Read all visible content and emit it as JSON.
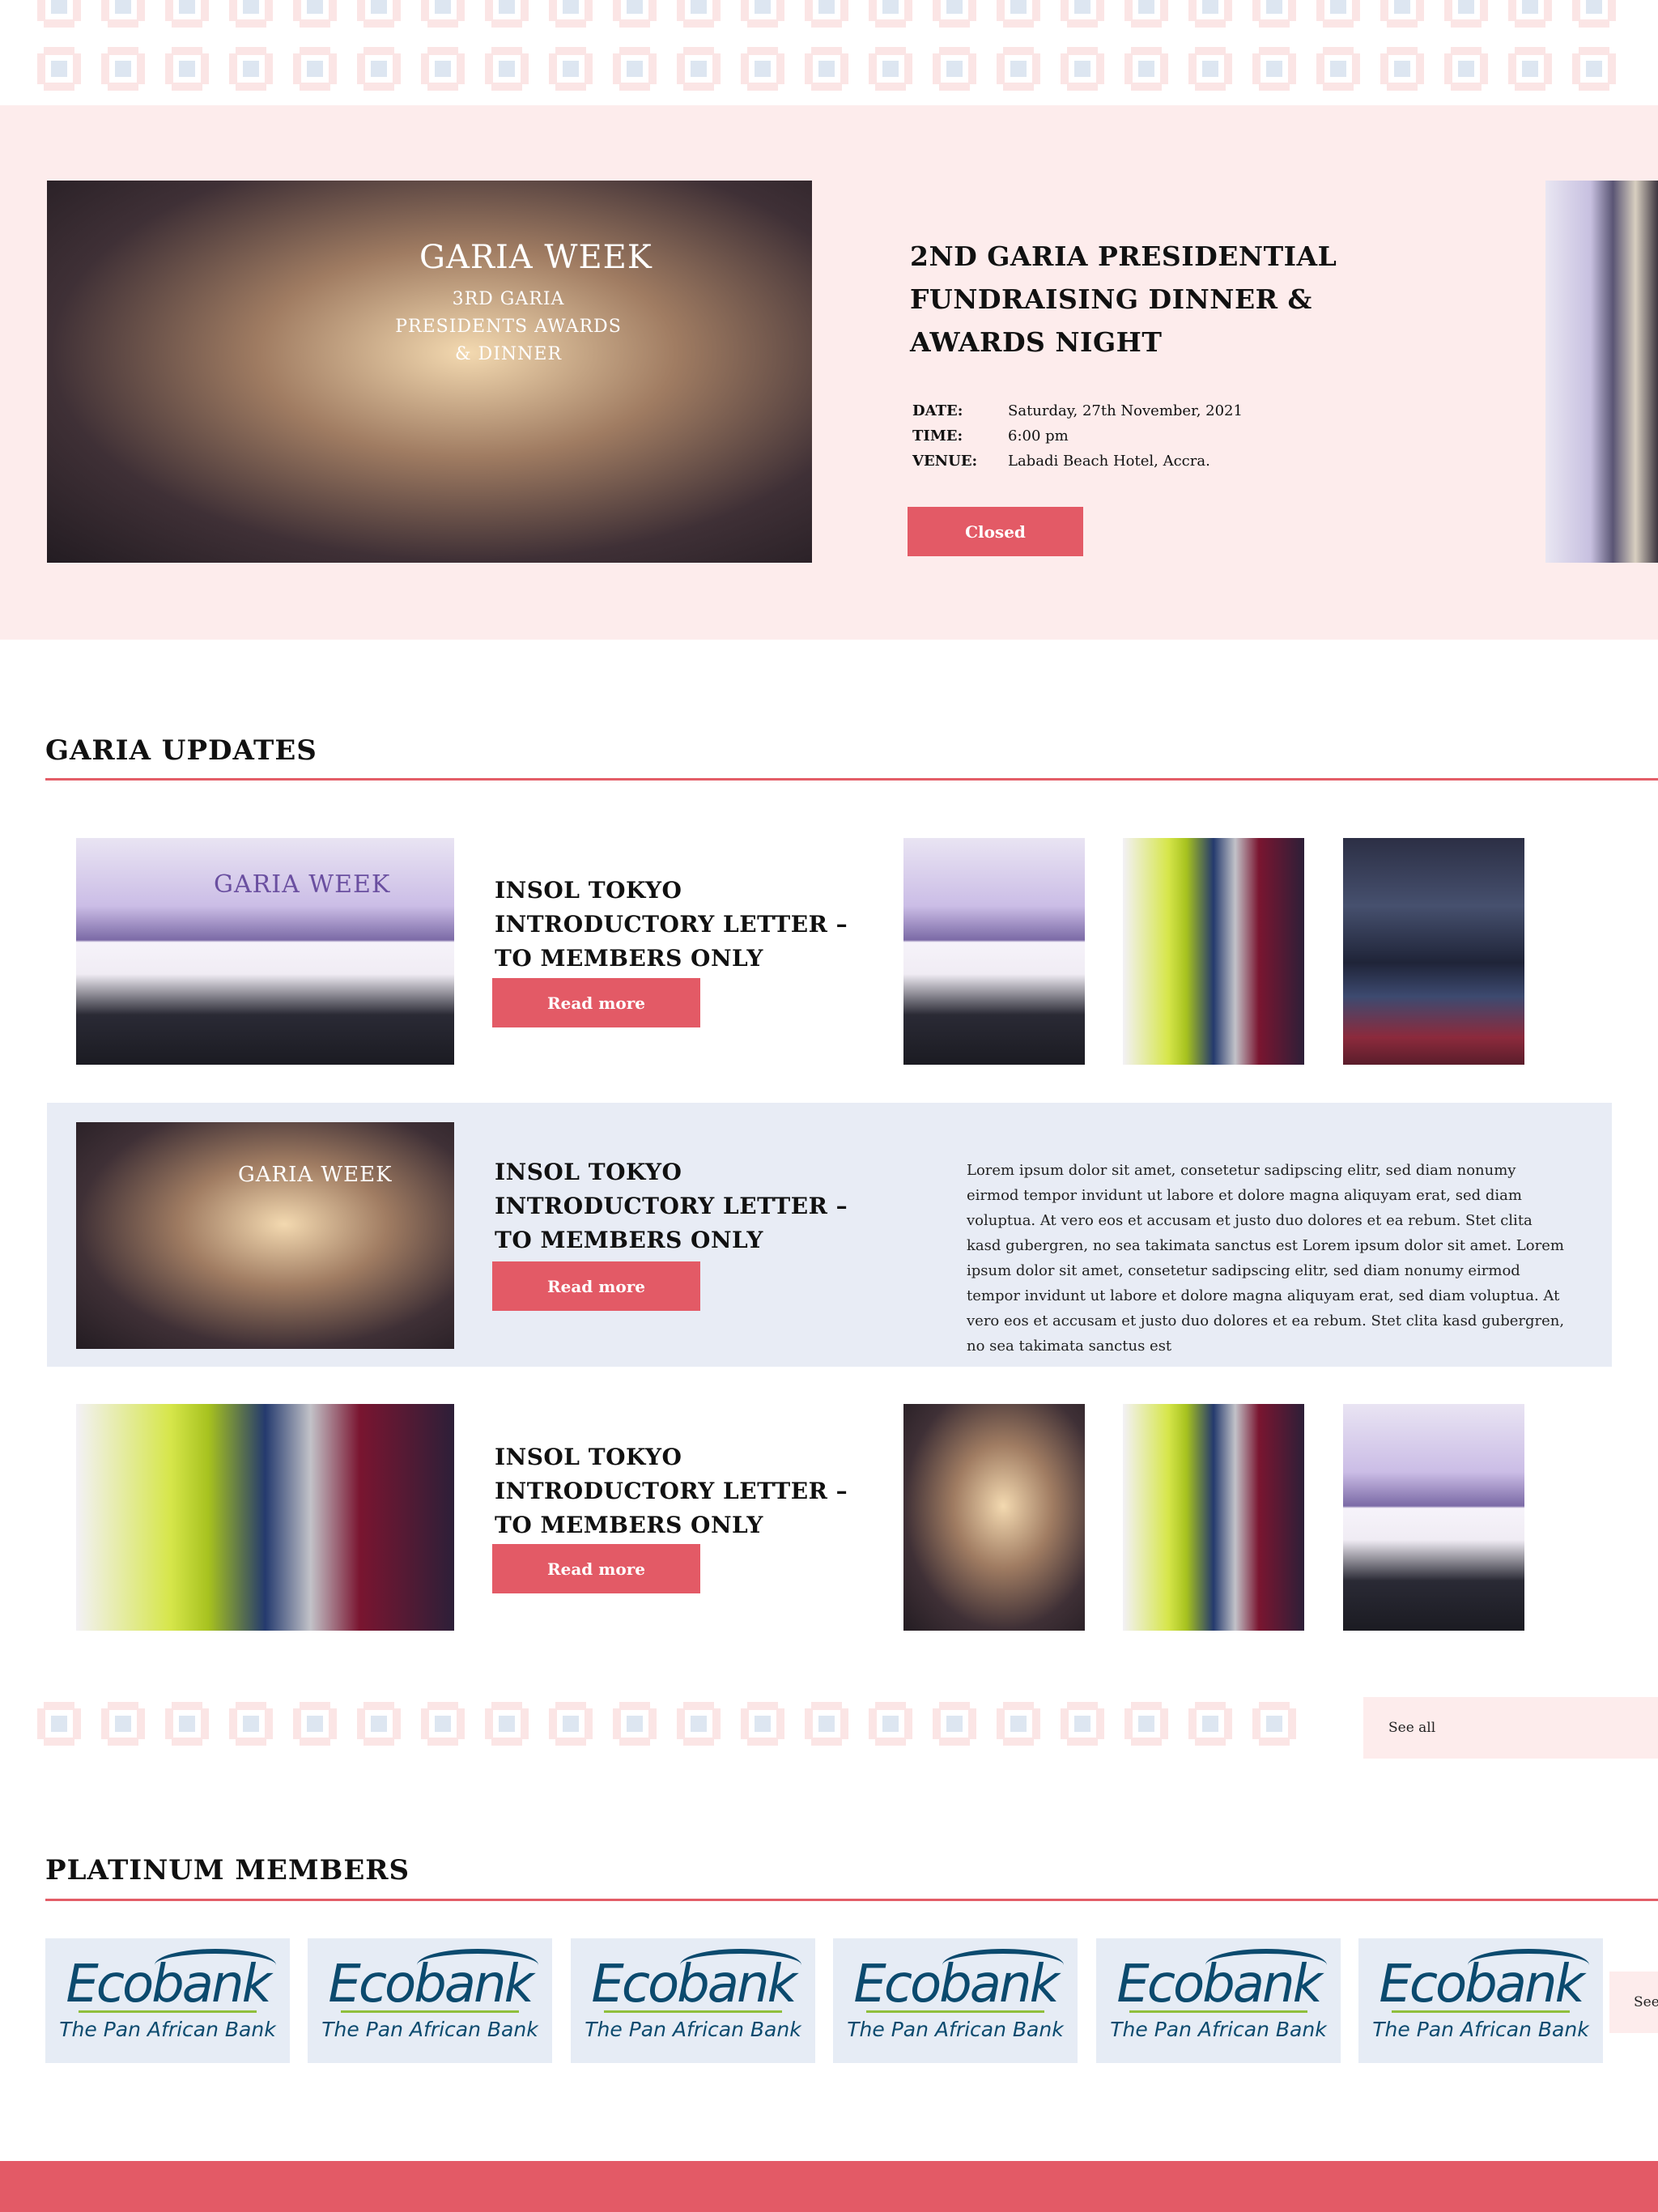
{
  "event": {
    "title": "2ND GARIA PRESIDENTIAL FUNDRAISING DINNER & AWARDS NIGHT",
    "date_label": "DATE:",
    "date_value": "Saturday, 27th November, 2021",
    "time_label": "TIME:",
    "time_value": "6:00 pm",
    "venue_label": "VENUE:",
    "venue_value": "Labadi Beach Hotel, Accra.",
    "status_button": "Closed",
    "image_caption": "GARIA WEEK",
    "image_sub": "3RD GARIA PRESIDENTS AWARDS & DINNER"
  },
  "updates": {
    "heading": "GARIA UPDATES",
    "items": [
      {
        "title": "INSOL TOKYO INTRODUCTORY LETTER – TO MEMBERS ONLY",
        "button": "Read more",
        "image_text": "GARIA WEEK"
      },
      {
        "title": "INSOL TOKYO INTRODUCTORY LETTER – TO MEMBERS ONLY",
        "button": "Read more",
        "image_text": "GARIA WEEK",
        "excerpt": "Lorem ipsum dolor sit amet, consetetur sadipscing elitr, sed diam nonumy eirmod tempor invidunt ut labore et dolore magna aliquyam erat, sed diam voluptua. At vero eos et accusam et justo duo dolores et ea rebum. Stet clita kasd gubergren, no sea takimata sanctus est Lorem ipsum dolor sit amet. Lorem ipsum dolor sit amet, consetetur sadipscing elitr, sed diam nonumy eirmod tempor invidunt ut labore et dolore magna aliquyam erat, sed diam voluptua. At vero eos et accusam et justo duo dolores et ea rebum. Stet clita kasd gubergren, no sea takimata sanctus est"
      },
      {
        "title": "INSOL TOKYO INTRODUCTORY LETTER – TO MEMBERS ONLY",
        "button": "Read more"
      }
    ],
    "see_all": "See all"
  },
  "members": {
    "heading": "PLATINUM MEMBERS",
    "logos": [
      {
        "name": "Ecobank",
        "tagline": "The Pan African Bank"
      },
      {
        "name": "Ecobank",
        "tagline": "The Pan African Bank"
      },
      {
        "name": "Ecobank",
        "tagline": "The Pan African Bank"
      },
      {
        "name": "Ecobank",
        "tagline": "The Pan African Bank"
      },
      {
        "name": "Ecobank",
        "tagline": "The Pan African Bank"
      },
      {
        "name": "Ecobank",
        "tagline": "The Pan African Bank"
      }
    ],
    "see_all_partial": "See"
  },
  "colors": {
    "accent": "#e35a66",
    "hero_bg": "#fdecec",
    "highlight_bg": "#e8ecf5",
    "brand_blue": "#0b4a6e"
  }
}
